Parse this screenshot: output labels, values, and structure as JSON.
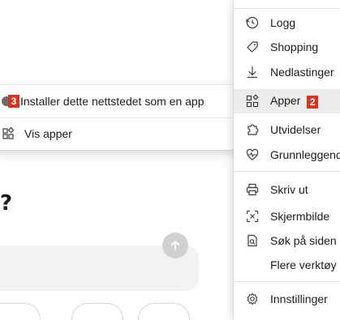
{
  "page": {
    "question_mark": "?"
  },
  "submenu": {
    "install_label": "Installer dette nettstedet som en app",
    "install_badge": "3",
    "view_apps_label": "Vis apper"
  },
  "menu": {
    "items": [
      {
        "label": "Logg",
        "icon": "history-icon"
      },
      {
        "label": "Shopping",
        "icon": "tag-icon"
      },
      {
        "label": "Nedlastinger",
        "icon": "download-icon"
      },
      {
        "label": "Apper",
        "icon": "apps-icon",
        "badge": "2"
      },
      {
        "label": "Utvidelser",
        "icon": "puzzle-icon"
      },
      {
        "label": "Grunnleggende",
        "icon": "heartbeat-icon"
      },
      {
        "label": "Skriv ut",
        "icon": "print-icon"
      },
      {
        "label": "Skjermbilde",
        "icon": "screenshot-icon"
      },
      {
        "label": "Søk på siden",
        "icon": "find-icon"
      },
      {
        "label": "Flere verktøy",
        "icon": ""
      },
      {
        "label": "Innstillinger",
        "icon": "gear-icon"
      }
    ]
  },
  "colors": {
    "badge": "#d9321f",
    "active_row": "#ececec"
  }
}
